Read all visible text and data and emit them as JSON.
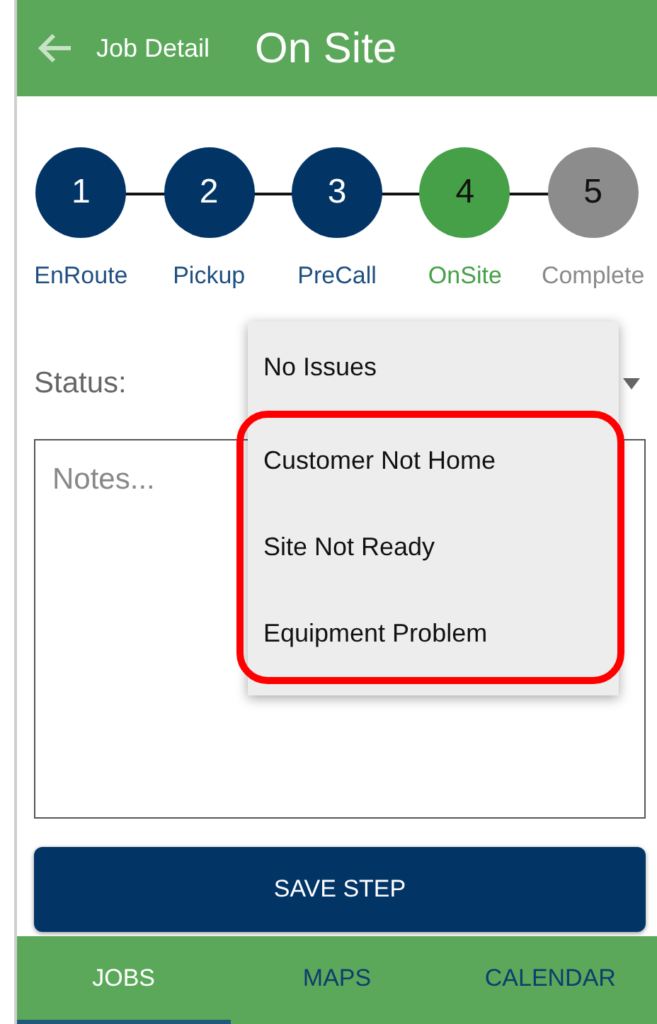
{
  "header": {
    "subtitle": "Job Detail",
    "title": "On Site"
  },
  "steps": [
    {
      "number": "1",
      "label": "EnRoute",
      "done": true,
      "current": false
    },
    {
      "number": "2",
      "label": "Pickup",
      "done": true,
      "current": false
    },
    {
      "number": "3",
      "label": "PreCall",
      "done": true,
      "current": false
    },
    {
      "number": "4",
      "label": "OnSite",
      "done": false,
      "current": true
    },
    {
      "number": "5",
      "label": "Complete",
      "done": false,
      "current": false
    }
  ],
  "status": {
    "label": "Status:",
    "expanded": true,
    "options": [
      {
        "label": "No Issues",
        "highlighted": false
      },
      {
        "label": "Customer Not Home",
        "highlighted": true
      },
      {
        "label": "Site Not Ready",
        "highlighted": true
      },
      {
        "label": "Equipment Problem",
        "highlighted": true
      }
    ]
  },
  "notes": {
    "placeholder": "Notes..."
  },
  "save_button": "SAVE STEP",
  "bottom_nav": [
    {
      "label": "JOBS",
      "selected": true
    },
    {
      "label": "MAPS",
      "selected": false
    },
    {
      "label": "CALENDAR",
      "selected": false
    }
  ]
}
